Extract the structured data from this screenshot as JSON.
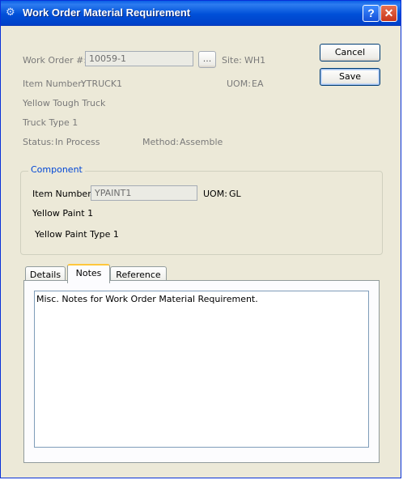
{
  "window": {
    "title": "Work Order Material Requirement",
    "help_label": "?",
    "close_label": "✕"
  },
  "header": {
    "work_order_label": "Work Order #:",
    "work_order_value": "10059-1",
    "lookup_label": "...",
    "site_label": "Site:",
    "site_value": "WH1",
    "item_number_label": "Item Number:",
    "item_number_value": "YTRUCK1",
    "uom_label": "UOM:",
    "uom_value": "EA",
    "description1": "Yellow Tough Truck",
    "description2": "Truck Type 1",
    "status_label": "Status:",
    "status_value": "In Process",
    "method_label": "Method:",
    "method_value": "Assemble"
  },
  "buttons": {
    "cancel_label": "Cancel",
    "save_label": "Save"
  },
  "component": {
    "title": "Component",
    "item_number_label": "Item Number:",
    "item_number_value": "YPAINT1",
    "uom_label": "UOM:",
    "uom_value": "GL",
    "description1": "Yellow Paint 1",
    "description2": "Yellow Paint Type 1"
  },
  "tabs": [
    {
      "label": "Details",
      "active": false
    },
    {
      "label": "Notes",
      "active": true
    },
    {
      "label": "Reference",
      "active": false
    }
  ],
  "notes": {
    "text": "Misc. Notes for Work Order Material Requirement."
  },
  "colors": {
    "titlebar": "#0050d8",
    "window_bg": "#ece9d8",
    "group_title": "#0046d5",
    "active_tab_accent": "#ffc73c"
  }
}
